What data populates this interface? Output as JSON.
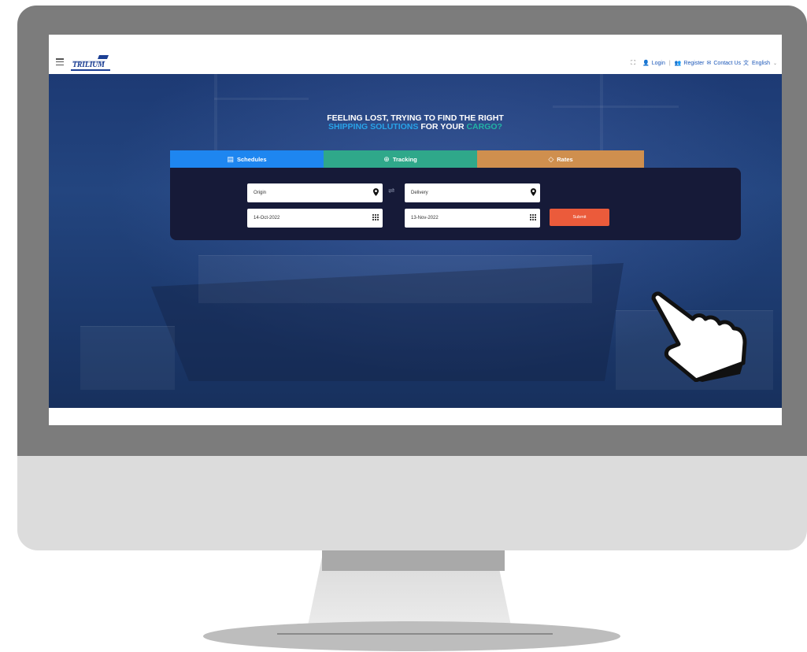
{
  "header": {
    "expand_icon": "expand-icon",
    "login_label": "Login",
    "register_label": "Register",
    "contact_label": "Contact Us",
    "language_label": "English",
    "logo_text": "TRILIUM"
  },
  "hero": {
    "headline_line1": "FEELING LOST, TRYING TO FIND THE RIGHT",
    "headline_part_blue": "SHIPPING SOLUTIONS",
    "headline_part_white": "FOR YOUR",
    "headline_part_teal": "CARGO?"
  },
  "tabs": [
    {
      "label": "Schedules",
      "color": "#1e86f0",
      "icon": "calendar-icon"
    },
    {
      "label": "Tracking",
      "color": "#2fa88a",
      "icon": "target-icon"
    },
    {
      "label": "Rates",
      "color": "#cf8f4e",
      "icon": "tag-icon"
    }
  ],
  "form": {
    "origin_placeholder": "Origin",
    "delivery_placeholder": "Delivery",
    "from_date": "14-Oct-2022",
    "to_date": "13-Nov-2022",
    "submit_label": "Submit"
  },
  "colors": {
    "accent_blue": "#1e86f0",
    "accent_teal": "#2fa88a",
    "accent_orange": "#cf8f4e",
    "submit_red": "#eb5b3b",
    "panel_dark": "#161a38"
  }
}
